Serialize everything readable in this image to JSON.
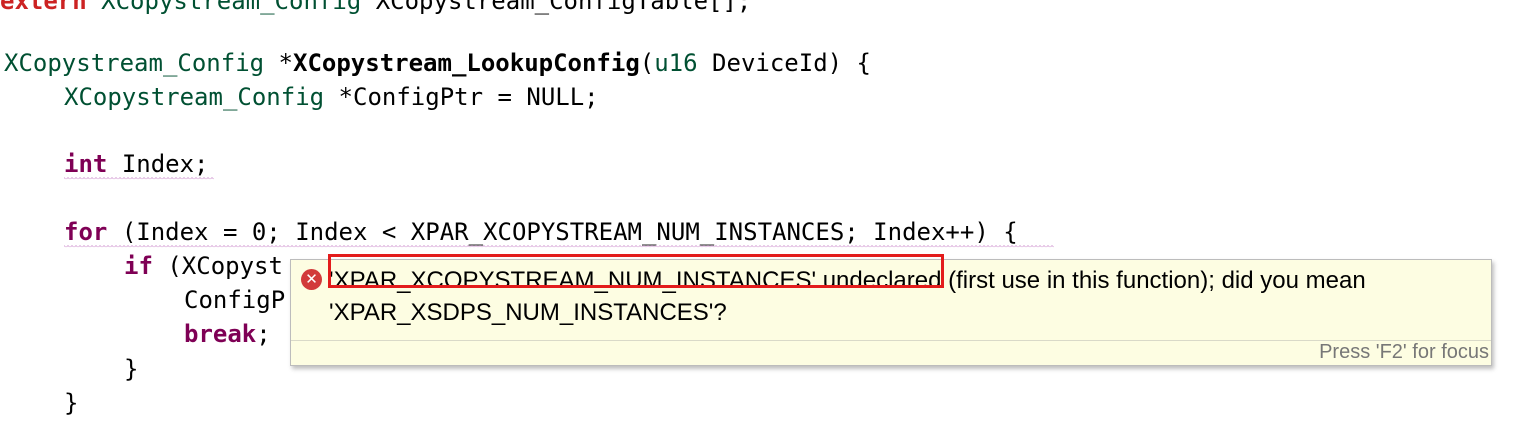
{
  "code": {
    "line0": {
      "kw": "extern",
      "type": "XCopystream_Config",
      "rest": "XCopystream_ConfigTable[];"
    },
    "line1": {
      "type": "XCopystream_Config",
      "pre": "*",
      "fn": "XCopystream_LookupConfig",
      "open": "(",
      "ptype": "u16",
      "rest": " DeviceId) {"
    },
    "line2": {
      "type": "XCopystream_Config",
      "rest": "*ConfigPtr = NULL;"
    },
    "line3": {
      "kw": "int",
      "rest": "Index;"
    },
    "line4": {
      "kw": "for",
      "rest": "(Index = 0; Index < XPAR_XCOPYSTREAM_NUM_INSTANCES; Index++) {"
    },
    "line5": {
      "kw": "if",
      "rest": "(XCopyst"
    },
    "line6": {
      "rest": "ConfigP"
    },
    "line7": {
      "kw": "break",
      "rest": ";"
    },
    "line8": {
      "rest": "}"
    },
    "line9": {
      "rest": "}"
    }
  },
  "hover": {
    "line1": "'XPAR_XCOPYSTREAM_NUM_INSTANCES' undeclared (first use in this function); did you mean",
    "line2": "'XPAR_XSDPS_NUM_INSTANCES'?",
    "icon": "error-icon",
    "footer": "Press 'F2' for focus"
  },
  "colors": {
    "type": "#005032",
    "keyword": "#7f0055",
    "tooltip_bg": "#fdfde2",
    "highlight": "#e31c1c"
  }
}
